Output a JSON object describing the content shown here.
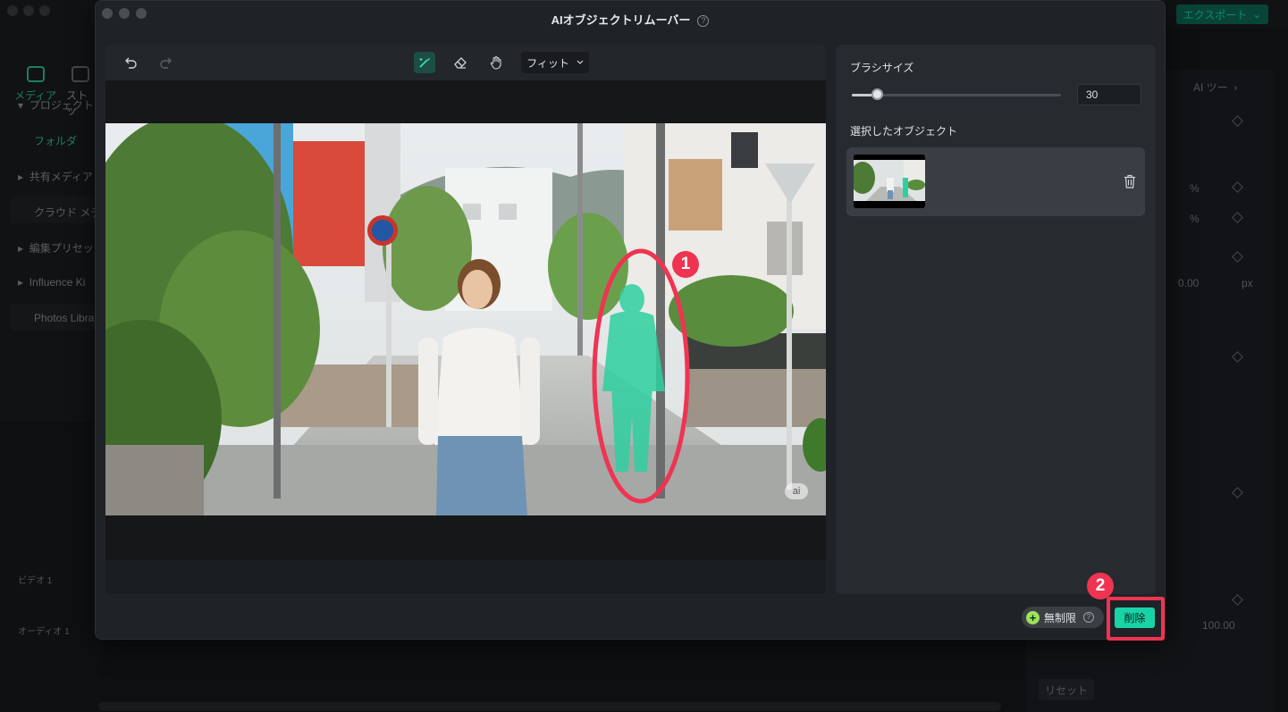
{
  "background_app": {
    "export_label": "エクスポート",
    "tabs": [
      {
        "label": "メディア",
        "icon": "media-icon"
      },
      {
        "label": "ストッ",
        "icon": "stock-icon"
      }
    ],
    "tree": [
      {
        "label": "プロジェクト"
      },
      {
        "label": "フォルダ"
      },
      {
        "label": "共有メディア"
      },
      {
        "label": "クラウド メデ"
      },
      {
        "label": "編集プリセッ"
      },
      {
        "label": "Influence Ki"
      },
      {
        "label": "Photos Libra"
      }
    ],
    "tracks": {
      "video": "ビデオ 1",
      "audio": "オーディオ 1"
    },
    "right_panel": {
      "ai_tools": "AI ツー",
      "percent_1": "%",
      "percent_2": "%",
      "px_value": "0.00",
      "px_unit": "px",
      "value_100": "100.00",
      "reset": "リセット"
    }
  },
  "modal": {
    "title": "AIオブジェクトリムーバー",
    "toolbar": {
      "undo_icon": "undo-icon",
      "redo_icon": "redo-icon",
      "brush_icon": "magic-brush-icon",
      "eraser_icon": "eraser-icon",
      "hand_icon": "hand-icon",
      "fit_label": "フィット"
    },
    "side_panel": {
      "brush_size_label": "ブラシサイズ",
      "brush_size_value": "30",
      "brush_size_fraction": 0.12,
      "selected_objects_label": "選択したオブジェクト"
    },
    "footer": {
      "unlimited_label": "無制限",
      "delete_label": "削除"
    },
    "watermark": "ai"
  },
  "annotations": {
    "badge_1": "1",
    "badge_2": "2",
    "accent_color": "#ef3452"
  },
  "colors": {
    "brand_green": "#19d3a6",
    "mask_green": "#2fd0a0",
    "annotation_red": "#ef3452"
  }
}
